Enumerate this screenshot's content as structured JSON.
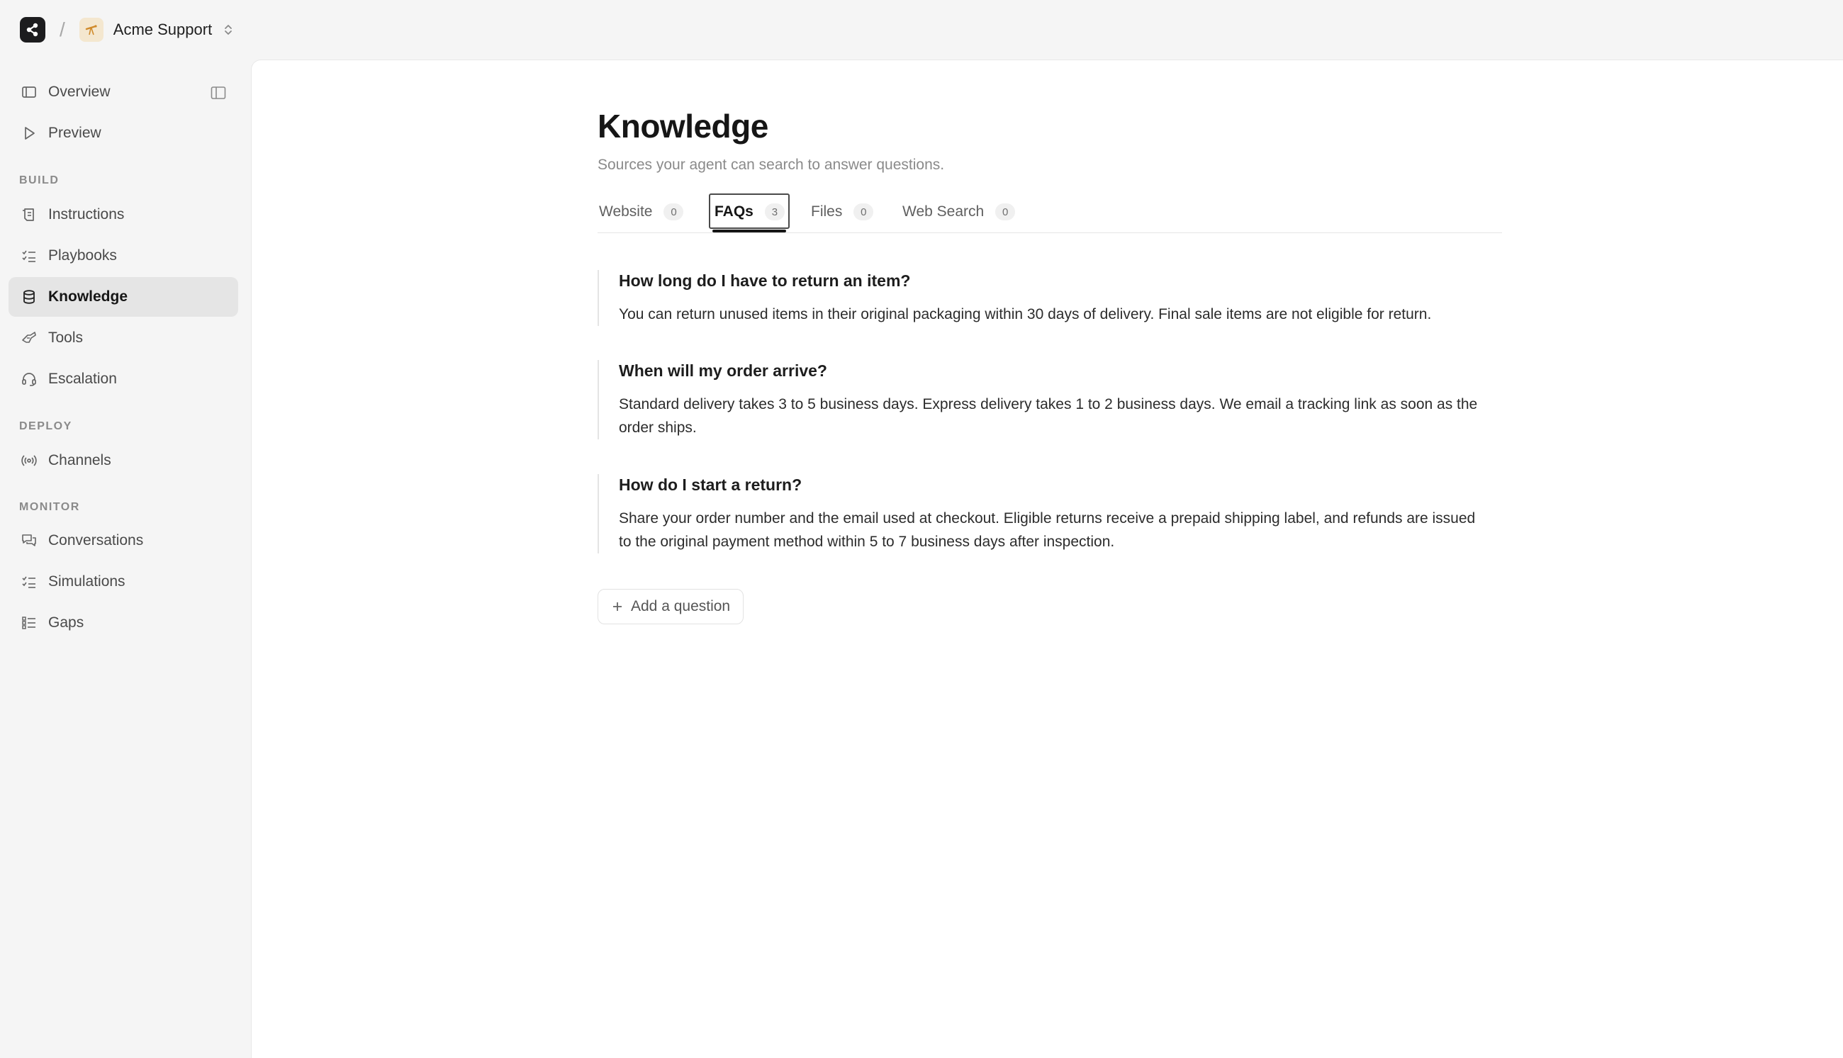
{
  "topbar": {
    "separator": "/",
    "workspace_name": "Acme Support"
  },
  "sidebar": {
    "top_items": [
      {
        "label": "Overview",
        "icon": "overview-icon"
      },
      {
        "label": "Preview",
        "icon": "play-icon"
      }
    ],
    "sections": [
      {
        "label": "BUILD",
        "items": [
          {
            "label": "Instructions",
            "icon": "instructions-icon"
          },
          {
            "label": "Playbooks",
            "icon": "checklist-icon"
          },
          {
            "label": "Knowledge",
            "icon": "database-icon",
            "active": true
          },
          {
            "label": "Tools",
            "icon": "tools-icon"
          },
          {
            "label": "Escalation",
            "icon": "headset-icon"
          }
        ]
      },
      {
        "label": "DEPLOY",
        "items": [
          {
            "label": "Channels",
            "icon": "broadcast-icon"
          }
        ]
      },
      {
        "label": "MONITOR",
        "items": [
          {
            "label": "Conversations",
            "icon": "chat-icon"
          },
          {
            "label": "Simulations",
            "icon": "checklist-icon"
          },
          {
            "label": "Gaps",
            "icon": "list-icon"
          }
        ]
      }
    ]
  },
  "main": {
    "title": "Knowledge",
    "subtitle": "Sources your agent can search to answer questions.",
    "tabs": [
      {
        "label": "Website",
        "count": "0"
      },
      {
        "label": "FAQs",
        "count": "3",
        "active": true
      },
      {
        "label": "Files",
        "count": "0"
      },
      {
        "label": "Web Search",
        "count": "0"
      }
    ],
    "faqs": [
      {
        "question": "How long do I have to return an item?",
        "answer": "You can return unused items in their original packaging within 30 days of delivery. Final sale items are not eligible for return."
      },
      {
        "question": "When will my order arrive?",
        "answer": "Standard delivery takes 3 to 5 business days. Express delivery takes 1 to 2 business days. We email a tracking link as soon as the order ships."
      },
      {
        "question": "How do I start a return?",
        "answer": "Share your order number and the email used at checkout. Eligible returns receive a prepaid shipping label, and refunds are issued to the original payment method within 5 to 7 business days after inspection."
      }
    ],
    "add_question_label": "Add a question"
  }
}
